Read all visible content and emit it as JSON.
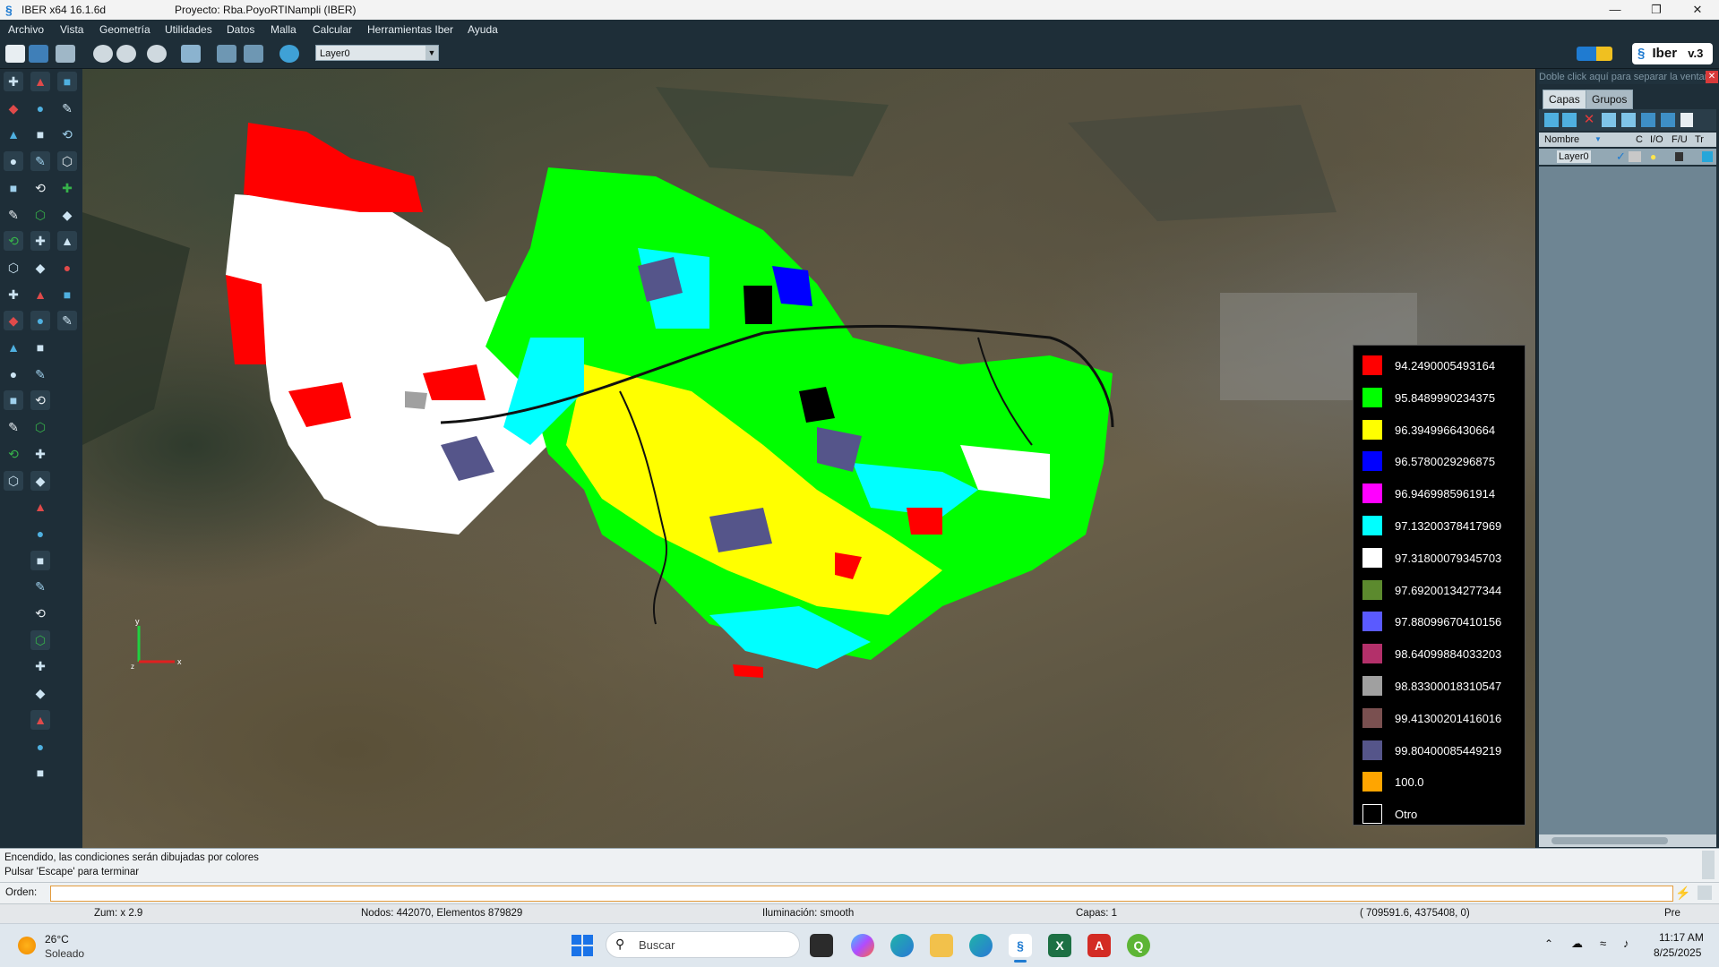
{
  "window": {
    "app_title": "IBER x64 16.1.6d",
    "project_title": "Proyecto: Rba.PoyoRTINampli (IBER)"
  },
  "menu": [
    "Archivo",
    "Vista",
    "Geometría",
    "Utilidades",
    "Datos",
    "Malla",
    "Calcular",
    "Herramientas Iber",
    "Ayuda"
  ],
  "toolbar": {
    "layer_select": "Layer0",
    "logo_text": "Iber",
    "logo_version": "v.3"
  },
  "legend": {
    "entries": [
      {
        "label": "94.2490005493164",
        "color": "#ff0000"
      },
      {
        "label": "95.8489990234375",
        "color": "#00ff00"
      },
      {
        "label": "96.3949966430664",
        "color": "#ffff00"
      },
      {
        "label": "96.5780029296875",
        "color": "#0000ff"
      },
      {
        "label": "96.9469985961914",
        "color": "#ff00ff"
      },
      {
        "label": "97.13200378417969",
        "color": "#00ffff"
      },
      {
        "label": "97.31800079345703",
        "color": "#ffffff"
      },
      {
        "label": "97.69200134277344",
        "color": "#5c8a2e"
      },
      {
        "label": "97.88099670410156",
        "color": "#5a5aff"
      },
      {
        "label": "98.64099884033203",
        "color": "#b3306a"
      },
      {
        "label": "98.83300018310547",
        "color": "#a0a0a0"
      },
      {
        "label": "99.41300201416016",
        "color": "#7a5050"
      },
      {
        "label": "99.80400085449219",
        "color": "#55558a"
      },
      {
        "label": "100.0",
        "color": "#ffa500"
      },
      {
        "label": "Otro",
        "color": "#000000"
      }
    ]
  },
  "axes": {
    "y": "y",
    "x": "x",
    "z": "z"
  },
  "right_panel": {
    "hint": "Doble click aquí para separar la ventana",
    "tab_layers": "Capas",
    "tab_groups": "Grupos",
    "col_name": "Nombre",
    "col_c": "C",
    "col_io": "I/O",
    "col_fu": "F/U",
    "col_tr": "Tr",
    "layer_name": "Layer0"
  },
  "console": {
    "line1": "Encendido, las condiciones serán dibujadas por colores",
    "line2": "Pulsar 'Escape' para terminar",
    "orden_label": "Orden:"
  },
  "status": {
    "zoom": "Zum: x 2.9",
    "nodes": "Nodos: 442070, Elementos 879829",
    "lighting": "Iluminación: smooth",
    "layers": "Capas: 1",
    "coords": "( 709591.6, 4375408, 0)",
    "pre": "Pre"
  },
  "taskbar": {
    "temp": "26°C",
    "weather": "Soleado",
    "search_placeholder": "Buscar",
    "time": "11:17 AM",
    "date": "8/25/2025"
  },
  "colors": {
    "chrome": "#1e2e38",
    "accent": "#1f7bd1"
  }
}
